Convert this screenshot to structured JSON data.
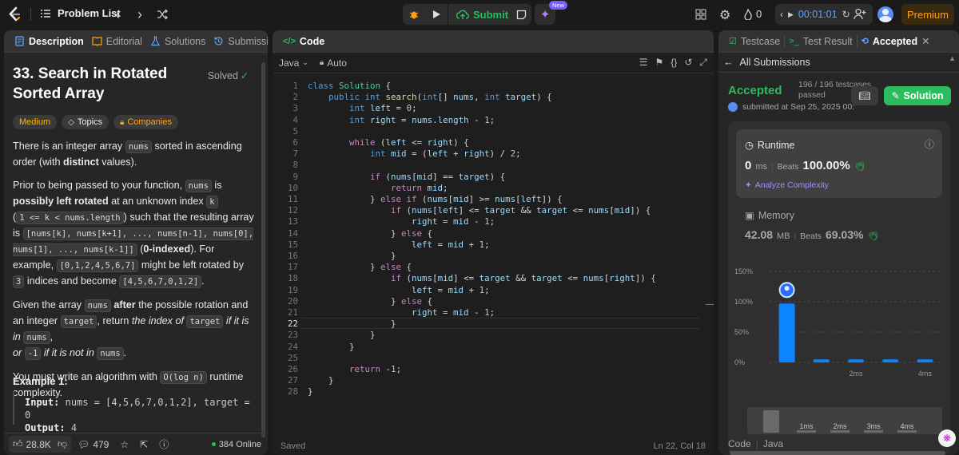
{
  "topbar": {
    "problem_list": "Problem List",
    "submit": "Submit",
    "new_badge": "New",
    "streak": "0",
    "timer": "00:01:01",
    "premium": "Premium"
  },
  "description": {
    "tabs": [
      "Description",
      "Editorial",
      "Solutions",
      "Submissions"
    ],
    "title_line1": "33. Search in Rotated",
    "title_line2": "Sorted Array",
    "solved": "Solved",
    "tags": [
      "Medium",
      "Topics",
      "Companies"
    ],
    "p1": {
      "a": "There is an integer array ",
      "c1": "nums",
      "b": " sorted in ascending order (with ",
      "bold": "distinct",
      "c": " values)."
    },
    "p2": {
      "a": "Prior to being passed to your function, ",
      "c1": "nums",
      "b": " is ",
      "bold1": "possibly left rotated",
      "c": " at an unknown index ",
      "c2": "k",
      "d": " (",
      "c3": "1 <= k < nums.length",
      "e": ") such that the resulting array is ",
      "c4": "[nums[k], nums[k+1], ..., nums[n-1], nums[0], nums[1], ..., nums[k-1]]",
      "f": " (",
      "bold2": "0-indexed",
      "g": "). For example, ",
      "c5": "[0,1,2,4,5,6,7]",
      "h": " might be left rotated by ",
      "c6": "3",
      "i": " indices and become ",
      "c7": "[4,5,6,7,0,1,2]",
      "j": "."
    },
    "p3": {
      "a": "Given the array ",
      "c1": "nums",
      "bold": " after",
      "b": " the possible rotation and an integer ",
      "c2": "target",
      "c": ", return ",
      "it1": "the index of ",
      "c3": "target",
      "it2": " if it is in ",
      "c4": "nums",
      "d": ",",
      "it3": "or ",
      "c5": "-1",
      "it4": " if it is not in ",
      "c6": "nums",
      "e": "."
    },
    "p4": {
      "a": "You must write an algorithm with ",
      "c1": "O(log n)",
      "b": " runtime complexity."
    },
    "example_title": "Example 1:",
    "ex_input_label": "Input:",
    "ex_input": "nums = [4,5,6,7,0,1,2], target = 0",
    "ex_output_label": "Output:",
    "ex_output": "4",
    "footer": {
      "likes": "28.8K",
      "comments": "479",
      "online": "384 Online"
    }
  },
  "editor": {
    "title": "Code",
    "language": "Java",
    "auto": "Auto",
    "status": "Saved",
    "cursor": "Ln 22, Col 18",
    "current_line": 22,
    "lines": [
      [
        [
          "kw",
          "class "
        ],
        [
          "cls",
          "Solution "
        ],
        [
          "plain",
          "{"
        ]
      ],
      [
        [
          "plain",
          "    "
        ],
        [
          "kw",
          "public "
        ],
        [
          "ty",
          "int "
        ],
        [
          "fn",
          "search"
        ],
        [
          "plain",
          "("
        ],
        [
          "ty",
          "int"
        ],
        [
          "plain",
          "[] "
        ],
        [
          "var",
          "nums"
        ],
        [
          "plain",
          ", "
        ],
        [
          "ty",
          "int "
        ],
        [
          "var",
          "target"
        ],
        [
          "plain",
          ") {"
        ]
      ],
      [
        [
          "plain",
          "        "
        ],
        [
          "ty",
          "int "
        ],
        [
          "var",
          "left"
        ],
        [
          "plain",
          " = "
        ],
        [
          "num",
          "0"
        ],
        [
          "plain",
          ";"
        ]
      ],
      [
        [
          "plain",
          "        "
        ],
        [
          "ty",
          "int "
        ],
        [
          "var",
          "right"
        ],
        [
          "plain",
          " = "
        ],
        [
          "var",
          "nums"
        ],
        [
          "plain",
          "."
        ],
        [
          "var",
          "length"
        ],
        [
          "plain",
          " - "
        ],
        [
          "num",
          "1"
        ],
        [
          "plain",
          ";"
        ]
      ],
      [],
      [
        [
          "plain",
          "        "
        ],
        [
          "ctl",
          "while "
        ],
        [
          "plain",
          "("
        ],
        [
          "var",
          "left"
        ],
        [
          "plain",
          " <= "
        ],
        [
          "var",
          "right"
        ],
        [
          "plain",
          ") {"
        ]
      ],
      [
        [
          "plain",
          "            "
        ],
        [
          "ty",
          "int "
        ],
        [
          "var",
          "mid"
        ],
        [
          "plain",
          " = ("
        ],
        [
          "var",
          "left"
        ],
        [
          "plain",
          " + "
        ],
        [
          "var",
          "right"
        ],
        [
          "plain",
          ") / "
        ],
        [
          "num",
          "2"
        ],
        [
          "plain",
          ";"
        ]
      ],
      [],
      [
        [
          "plain",
          "            "
        ],
        [
          "ctl",
          "if "
        ],
        [
          "plain",
          "("
        ],
        [
          "var",
          "nums"
        ],
        [
          "plain",
          "["
        ],
        [
          "var",
          "mid"
        ],
        [
          "plain",
          "] == "
        ],
        [
          "var",
          "target"
        ],
        [
          "plain",
          ") {"
        ]
      ],
      [
        [
          "plain",
          "                "
        ],
        [
          "ctl",
          "return "
        ],
        [
          "var",
          "mid"
        ],
        [
          "plain",
          ";"
        ]
      ],
      [
        [
          "plain",
          "            } "
        ],
        [
          "ctl",
          "else if "
        ],
        [
          "plain",
          "("
        ],
        [
          "var",
          "nums"
        ],
        [
          "plain",
          "["
        ],
        [
          "var",
          "mid"
        ],
        [
          "plain",
          "] >= "
        ],
        [
          "var",
          "nums"
        ],
        [
          "plain",
          "["
        ],
        [
          "var",
          "left"
        ],
        [
          "plain",
          "]) {"
        ]
      ],
      [
        [
          "plain",
          "                "
        ],
        [
          "ctl",
          "if "
        ],
        [
          "plain",
          "("
        ],
        [
          "var",
          "nums"
        ],
        [
          "plain",
          "["
        ],
        [
          "var",
          "left"
        ],
        [
          "plain",
          "] <= "
        ],
        [
          "var",
          "target"
        ],
        [
          "plain",
          " && "
        ],
        [
          "var",
          "target"
        ],
        [
          "plain",
          " <= "
        ],
        [
          "var",
          "nums"
        ],
        [
          "plain",
          "["
        ],
        [
          "var",
          "mid"
        ],
        [
          "plain",
          "]) {"
        ]
      ],
      [
        [
          "plain",
          "                    "
        ],
        [
          "var",
          "right"
        ],
        [
          "plain",
          " = "
        ],
        [
          "var",
          "mid"
        ],
        [
          "plain",
          " - "
        ],
        [
          "num",
          "1"
        ],
        [
          "plain",
          ";"
        ]
      ],
      [
        [
          "plain",
          "                } "
        ],
        [
          "ctl",
          "else "
        ],
        [
          "plain",
          "{"
        ]
      ],
      [
        [
          "plain",
          "                    "
        ],
        [
          "var",
          "left"
        ],
        [
          "plain",
          " = "
        ],
        [
          "var",
          "mid"
        ],
        [
          "plain",
          " + "
        ],
        [
          "num",
          "1"
        ],
        [
          "plain",
          ";"
        ]
      ],
      [
        [
          "plain",
          "                }"
        ]
      ],
      [
        [
          "plain",
          "            } "
        ],
        [
          "ctl",
          "else "
        ],
        [
          "plain",
          "{"
        ]
      ],
      [
        [
          "plain",
          "                "
        ],
        [
          "ctl",
          "if "
        ],
        [
          "plain",
          "("
        ],
        [
          "var",
          "nums"
        ],
        [
          "plain",
          "["
        ],
        [
          "var",
          "mid"
        ],
        [
          "plain",
          "] <= "
        ],
        [
          "var",
          "target"
        ],
        [
          "plain",
          " && "
        ],
        [
          "var",
          "target"
        ],
        [
          "plain",
          " <= "
        ],
        [
          "var",
          "nums"
        ],
        [
          "plain",
          "["
        ],
        [
          "var",
          "right"
        ],
        [
          "plain",
          "]) {"
        ]
      ],
      [
        [
          "plain",
          "                    "
        ],
        [
          "var",
          "left"
        ],
        [
          "plain",
          " = "
        ],
        [
          "var",
          "mid"
        ],
        [
          "plain",
          " + "
        ],
        [
          "num",
          "1"
        ],
        [
          "plain",
          ";"
        ]
      ],
      [
        [
          "plain",
          "                } "
        ],
        [
          "ctl",
          "else "
        ],
        [
          "plain",
          "{"
        ]
      ],
      [
        [
          "plain",
          "                    "
        ],
        [
          "var",
          "right"
        ],
        [
          "plain",
          " = "
        ],
        [
          "var",
          "mid"
        ],
        [
          "plain",
          " - "
        ],
        [
          "num",
          "1"
        ],
        [
          "plain",
          ";"
        ]
      ],
      [
        [
          "plain",
          "                }"
        ]
      ],
      [
        [
          "plain",
          "            }"
        ]
      ],
      [
        [
          "plain",
          "        }"
        ]
      ],
      [],
      [
        [
          "plain",
          "        "
        ],
        [
          "ctl",
          "return "
        ],
        [
          "plain",
          "-"
        ],
        [
          "num",
          "1"
        ],
        [
          "plain",
          ";"
        ]
      ],
      [
        [
          "plain",
          "    }"
        ]
      ],
      [
        [
          "plain",
          "}"
        ]
      ]
    ]
  },
  "result": {
    "tabs": [
      "Testcase",
      "Test Result",
      "Accepted"
    ],
    "all_submissions": "All Submissions",
    "status": "Accepted",
    "testcases": "196 / 196 testcases",
    "passed": "passed",
    "submitted": "submitted at Sep 25, 2025 00:",
    "solution_btn": "Solution",
    "runtime_label": "Runtime",
    "runtime_value": "0",
    "runtime_unit": "ms",
    "beats_label": "Beats",
    "runtime_beats": "100.00%",
    "analyze": "Analyze Complexity",
    "memory_label": "Memory",
    "memory_value": "42.08",
    "memory_unit": "MB",
    "memory_beats": "69.03%",
    "code_label": "Code",
    "code_lang": "Java"
  },
  "chart_data": {
    "type": "bar",
    "y_ticks": [
      "150%",
      "100%",
      "50%",
      "0%"
    ],
    "ylim": [
      0,
      150
    ],
    "x_tick_labels": [
      "2ms",
      "4ms"
    ],
    "values": [
      97,
      5,
      5,
      5,
      5
    ],
    "mini_labels": [
      "1ms",
      "2ms",
      "3ms",
      "4ms"
    ],
    "bar_color": "#0a84ff"
  },
  "colors": {
    "accent_green": "#2cbb5d",
    "accent_orange": "#ffa116",
    "link_blue": "#0a84ff"
  }
}
